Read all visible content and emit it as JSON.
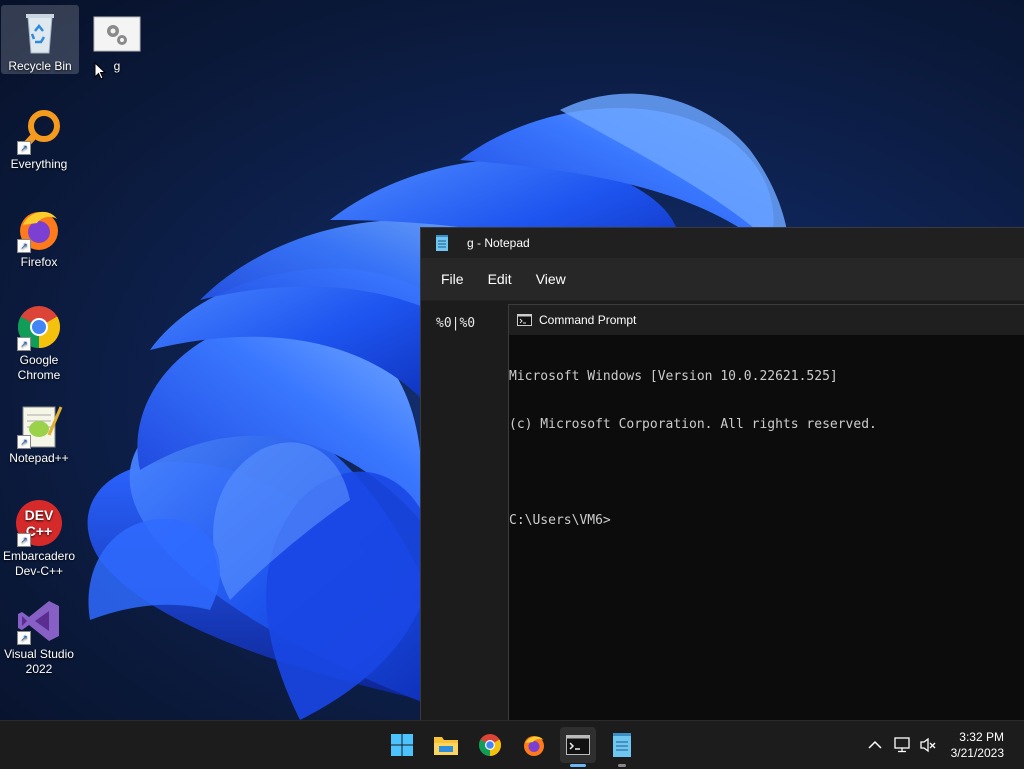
{
  "desktop": {
    "icons": [
      {
        "label": "Recycle Bin"
      },
      {
        "label": "g"
      },
      {
        "label": "Everything"
      },
      {
        "label": "Firefox"
      },
      {
        "label": "Google Chrome"
      },
      {
        "label": "Notepad++"
      },
      {
        "label": "Embarcadero Dev-C++"
      },
      {
        "label": "Visual Studio 2022"
      }
    ]
  },
  "notepad": {
    "title": "g - Notepad",
    "menu": [
      "File",
      "Edit",
      "View"
    ],
    "content": "%0|%0"
  },
  "cmd": {
    "title": "Command Prompt",
    "lines": [
      "Microsoft Windows [Version 10.0.22621.525]",
      "(c) Microsoft Corporation. All rights reserved.",
      "",
      "C:\\Users\\VM6>"
    ]
  },
  "taskbar": {
    "apps": [
      {
        "name": "start-icon"
      },
      {
        "name": "file-explorer-icon"
      },
      {
        "name": "chrome-icon"
      },
      {
        "name": "firefox-icon"
      },
      {
        "name": "command-prompt-icon"
      },
      {
        "name": "notepad-icon"
      }
    ],
    "clock": {
      "time": "3:32 PM",
      "date": "3/21/2023"
    }
  },
  "colors": {
    "accent": "#6cb8f6",
    "wallpaper_blue": "#1f5fff",
    "taskbar": "#1c1c1c"
  }
}
